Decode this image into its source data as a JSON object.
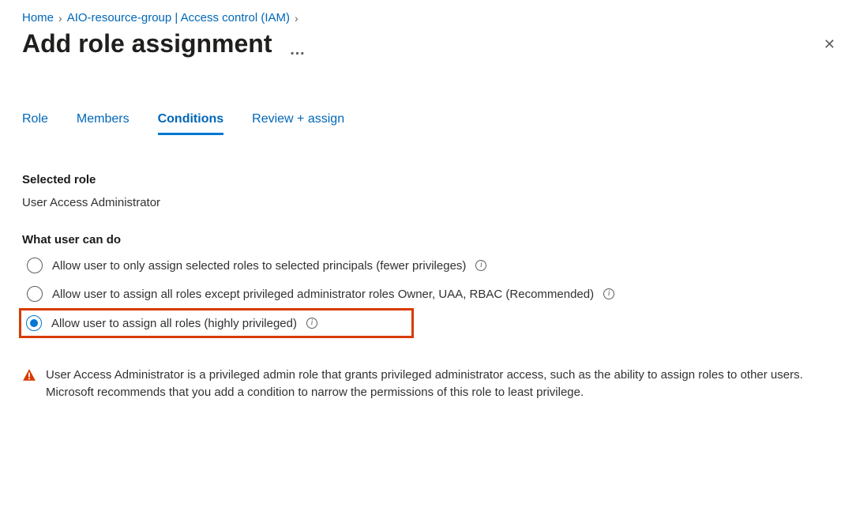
{
  "breadcrumb": {
    "home": "Home",
    "resource": "AIO-resource-group | Access control (IAM)"
  },
  "header": {
    "title": "Add role assignment",
    "more_label": "…"
  },
  "tabs": [
    {
      "label": "Role",
      "active": false
    },
    {
      "label": "Members",
      "active": false
    },
    {
      "label": "Conditions",
      "active": true
    },
    {
      "label": "Review + assign",
      "active": false
    }
  ],
  "selected_role": {
    "heading": "Selected role",
    "value": "User Access Administrator"
  },
  "what_user_can_do": {
    "heading": "What user can do",
    "options": [
      {
        "label": "Allow user to only assign selected roles to selected principals (fewer privileges)",
        "checked": false,
        "highlight": false
      },
      {
        "label": "Allow user to assign all roles except privileged administrator roles Owner, UAA, RBAC (Recommended)",
        "checked": false,
        "highlight": false
      },
      {
        "label": "Allow user to assign all roles (highly privileged)",
        "checked": true,
        "highlight": true
      }
    ]
  },
  "warning": {
    "text": "User Access Administrator is a privileged admin role that grants privileged administrator access, such as the ability to assign roles to other users. Microsoft recommends that you add a condition to narrow the permissions of this role to least privilege."
  },
  "icons": {
    "info": "i",
    "close": "✕"
  }
}
